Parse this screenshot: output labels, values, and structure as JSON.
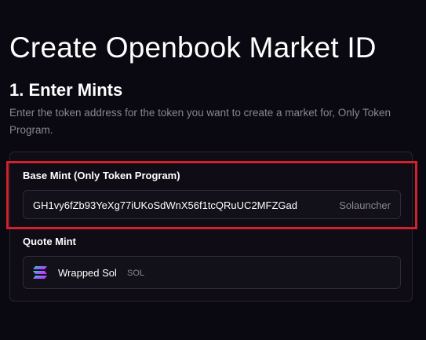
{
  "page": {
    "title": "Create Openbook Market ID"
  },
  "section": {
    "title": "1. Enter Mints",
    "description": "Enter the token address for the token you want to create a market for, Only Token Program."
  },
  "base_mint": {
    "label": "Base Mint (Only Token Program)",
    "value": "GH1vy6fZb93YeXg77iUKoSdWnX56f1tcQRuUC2MFZGad",
    "tag": "Solauncher"
  },
  "quote_mint": {
    "label": "Quote Mint",
    "token_name": "Wrapped Sol",
    "token_symbol": "SOL",
    "icon": "solana-icon"
  },
  "colors": {
    "background": "#0a0810",
    "highlight": "#d3202a",
    "muted_text": "#8b8594"
  }
}
